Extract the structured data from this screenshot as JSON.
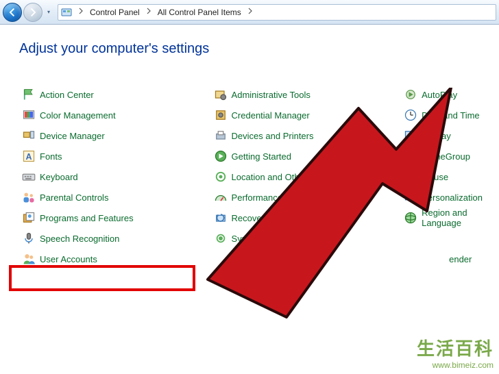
{
  "toolbar": {
    "breadcrumb": {
      "item1": "Control Panel",
      "item2": "All Control Panel Items"
    }
  },
  "heading": "Adjust your computer's settings",
  "col1": [
    "Action Center",
    "Color Management",
    "Device Manager",
    "Fonts",
    "Keyboard",
    "Parental Controls",
    "Programs and Features",
    "Speech Recognition",
    "User Accounts"
  ],
  "col2": [
    "Administrative Tools",
    "Credential Manager",
    "Devices and Printers",
    "Getting Started",
    "Location and Other Sensors",
    "Performance Informati",
    "Recovery",
    "Syn"
  ],
  "col3": [
    "AutoPlay",
    "Date and Time",
    "Display",
    "HomeGroup",
    "Mouse",
    "Personalization",
    "Region and Language",
    "",
    "ender"
  ],
  "watermark": {
    "chinese": "生活百科",
    "url": "www.bimeiz.com"
  }
}
